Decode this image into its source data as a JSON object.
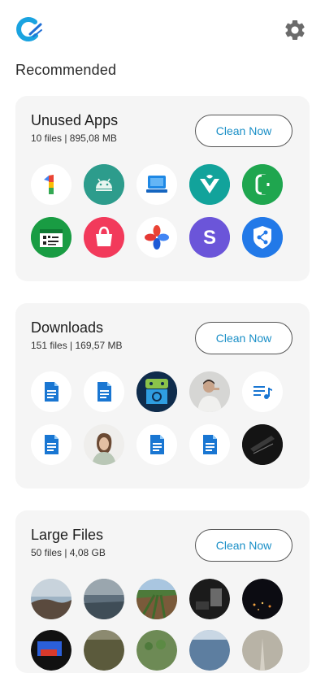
{
  "header": {
    "logo_icon": "app-logo-c-icon",
    "settings_icon": "gear-icon"
  },
  "recommended_label": "Recommended",
  "cards": [
    {
      "title": "Unused Apps",
      "subtitle": "10 files | 895,08 MB",
      "button_label": "Clean Now",
      "items": [
        "google-one-icon",
        "android-icon",
        "monitor-app-icon",
        "vector-v-icon",
        "phone-call-icon",
        "qr-scanner-icon",
        "shopping-bag-icon",
        "pinwheel-icon",
        "skype-s-icon",
        "share-shield-icon"
      ]
    },
    {
      "title": "Downloads",
      "subtitle": "151 files | 169,57 MB",
      "button_label": "Clean Now",
      "items": [
        "document-icon",
        "document-icon",
        "android-apk-thumbnail",
        "man-portrait-thumbnail",
        "audio-file-icon",
        "document-icon",
        "woman-portrait-thumbnail",
        "document-icon",
        "document-icon",
        "dark-photo-thumbnail"
      ]
    },
    {
      "title": "Large Files",
      "subtitle": "50 files | 4,08 GB",
      "button_label": "Clean Now",
      "items": [
        "rocky-shore-photo",
        "sea-photo",
        "field-photo",
        "dark-room-photo",
        "night-city-photo",
        "stage-photo",
        "dry-grass-photo",
        "vegetable-garden-photo",
        "sea-surface-photo",
        "path-photo"
      ]
    }
  ]
}
